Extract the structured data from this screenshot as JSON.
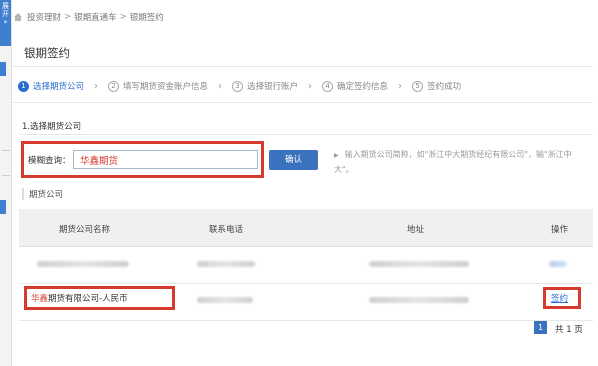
{
  "sidebar": {
    "expand_label": "展开 »"
  },
  "breadcrumb": {
    "items": [
      "投资理财",
      "银期直通车",
      "银期签约"
    ],
    "separator": ">"
  },
  "page": {
    "title": "银期签约"
  },
  "steps": [
    {
      "num": "1",
      "label": "选择期货公司",
      "active": true
    },
    {
      "num": "2",
      "label": "填写期货资金账户信息",
      "active": false
    },
    {
      "num": "3",
      "label": "选择银行账户",
      "active": false
    },
    {
      "num": "4",
      "label": "确定签约信息",
      "active": false
    },
    {
      "num": "5",
      "label": "签约成功",
      "active": false
    }
  ],
  "section": {
    "label": "1.选择期货公司"
  },
  "search": {
    "label": "模糊查询：",
    "value": "华鑫期货",
    "button_label": "确认",
    "hint": "输入期货公司简称，如\"浙江中大期货经纪有限公司\"，输\"浙江中大\"。"
  },
  "results": {
    "label": "期货公司",
    "columns": [
      "期货公司名称",
      "联系电话",
      "地址",
      "操作"
    ],
    "rows": [
      {
        "name": "",
        "phone": "",
        "address": "",
        "action": "",
        "blurred": true
      },
      {
        "name_highlight": "华鑫",
        "name_rest": "期货有限公司-人民币",
        "phone": "",
        "address": "",
        "action": "签约",
        "blurred": false
      }
    ]
  },
  "pagination": {
    "current": "1",
    "total_label": "共 1 页"
  },
  "colors": {
    "accent": "#3a72bd",
    "highlight_red": "#d63a2f"
  }
}
